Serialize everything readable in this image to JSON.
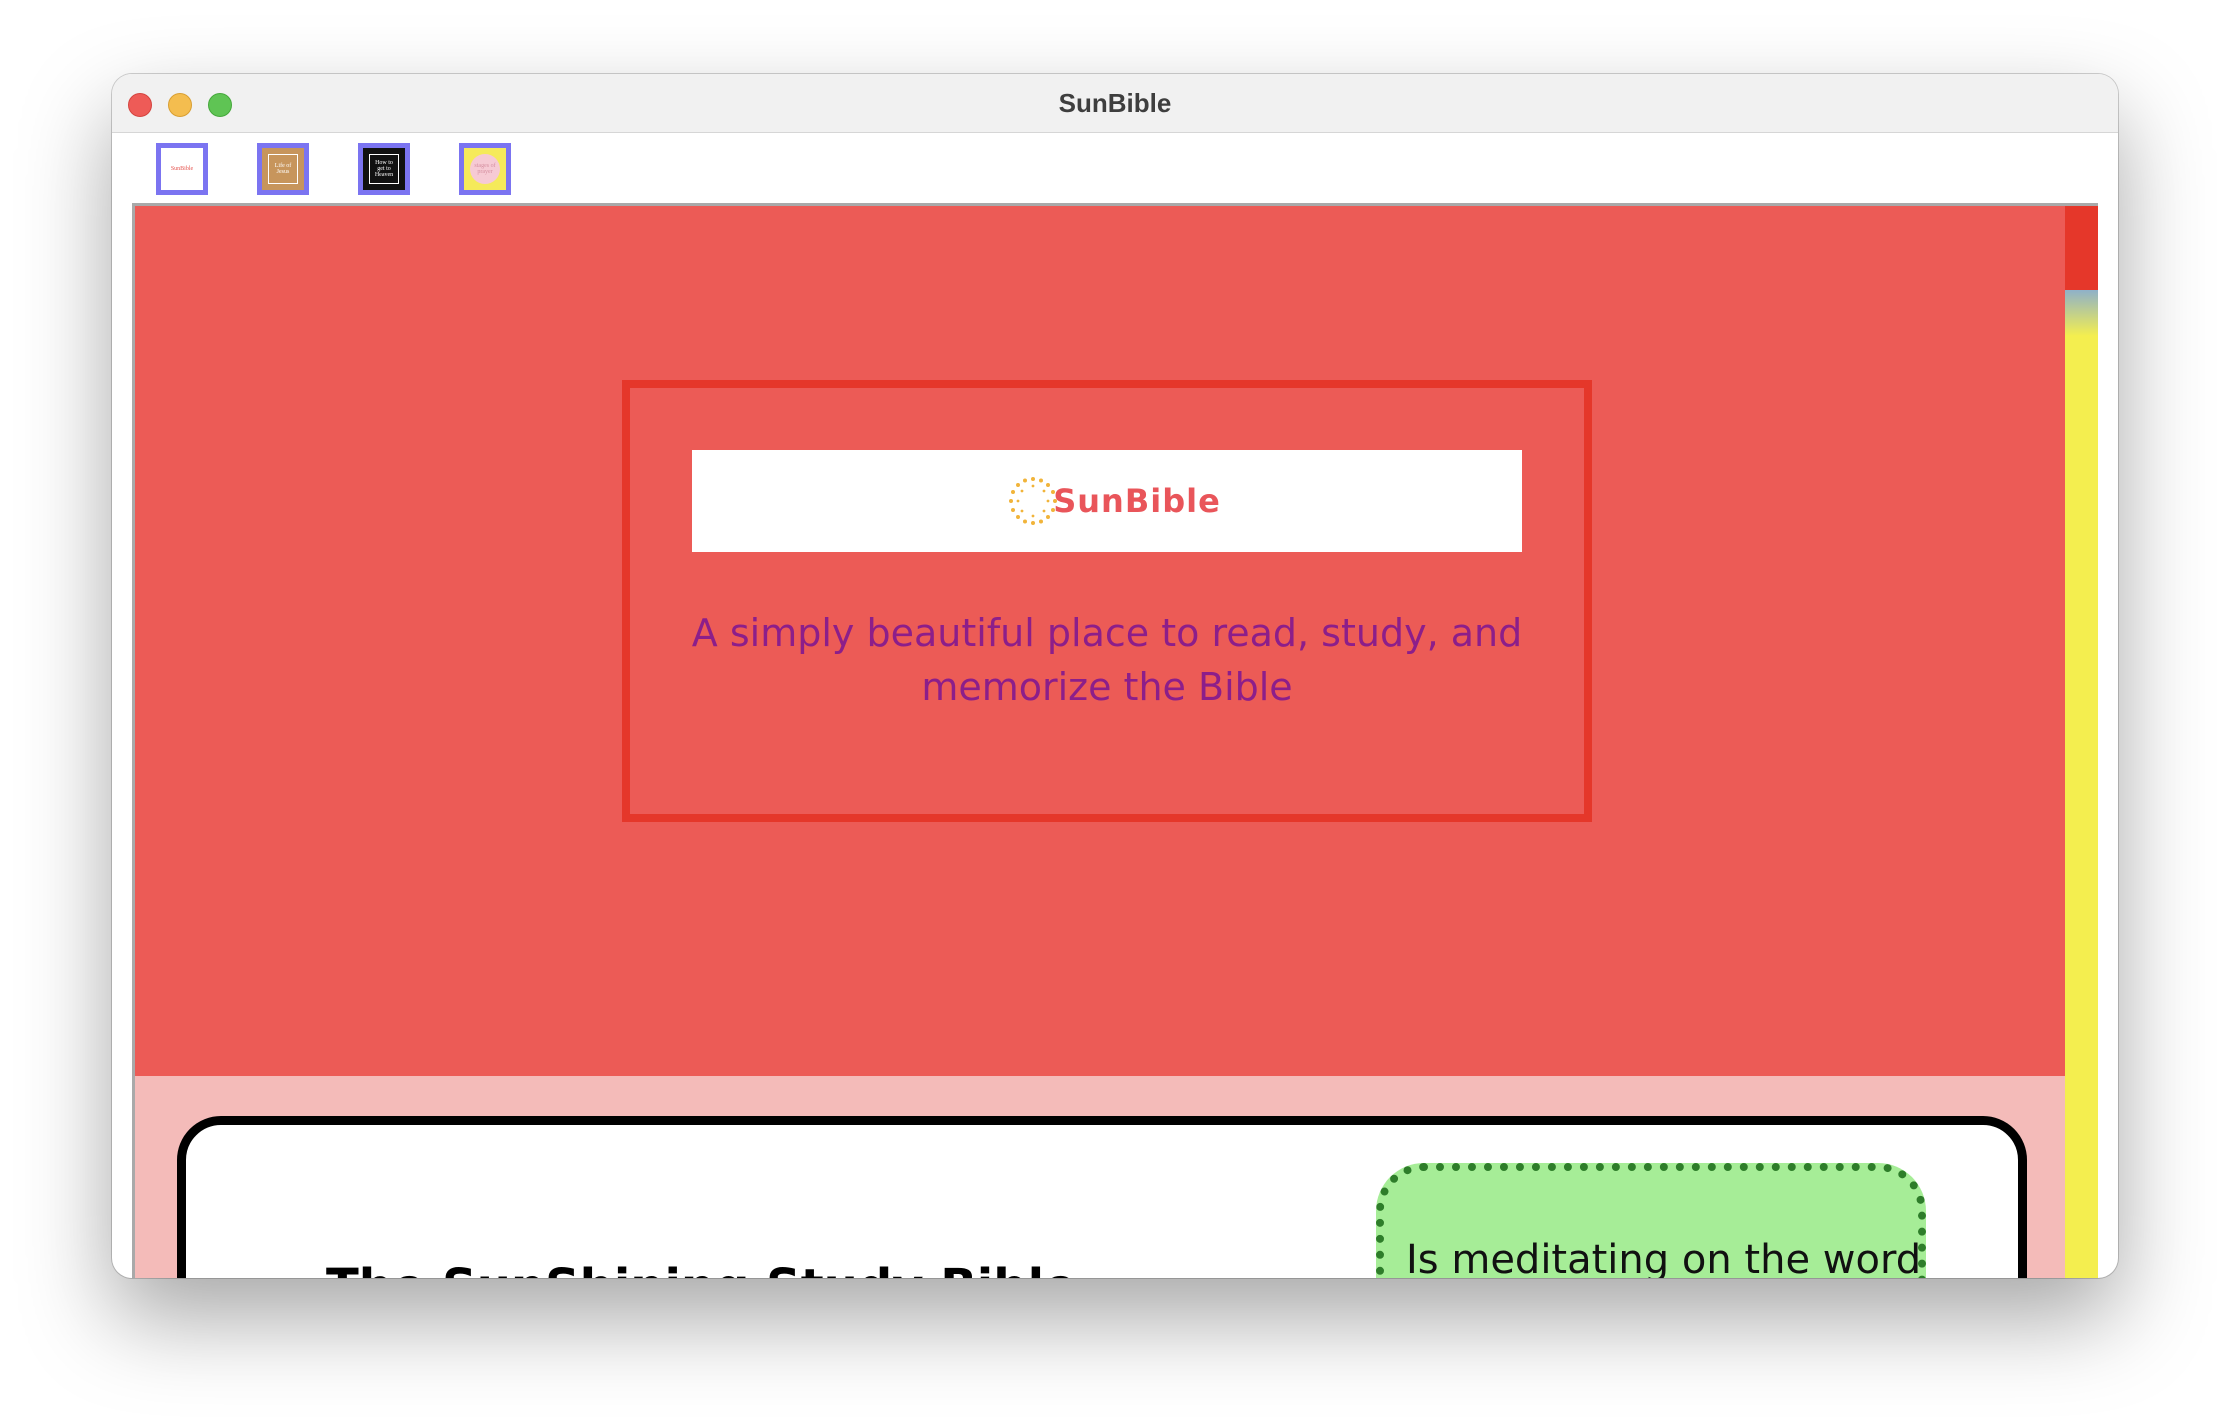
{
  "window": {
    "title": "SunBible"
  },
  "tabs": [
    {
      "label": "SunBible",
      "color": "#ffffff"
    },
    {
      "label": "Life of Jesus",
      "color": "#c7955c"
    },
    {
      "label": "How to get to Heaven",
      "color": "#111111"
    },
    {
      "label": "stages of prayer",
      "color": "#f5ea5a"
    }
  ],
  "hero": {
    "logo_text": "SunBible",
    "tagline": "A simply beautiful place to read, study, and memorize the Bible",
    "background": "#ec5b56",
    "border_color": "#e5372a",
    "tagline_color": "#8c1e8a"
  },
  "card": {
    "heading": "The SunShining Study Bible",
    "quote": "Is meditating on the word",
    "quote_bg": "#a6ed97"
  },
  "scrollbar": {
    "thumb_color": "#e5372a",
    "track_color": "#f4ee4f"
  }
}
